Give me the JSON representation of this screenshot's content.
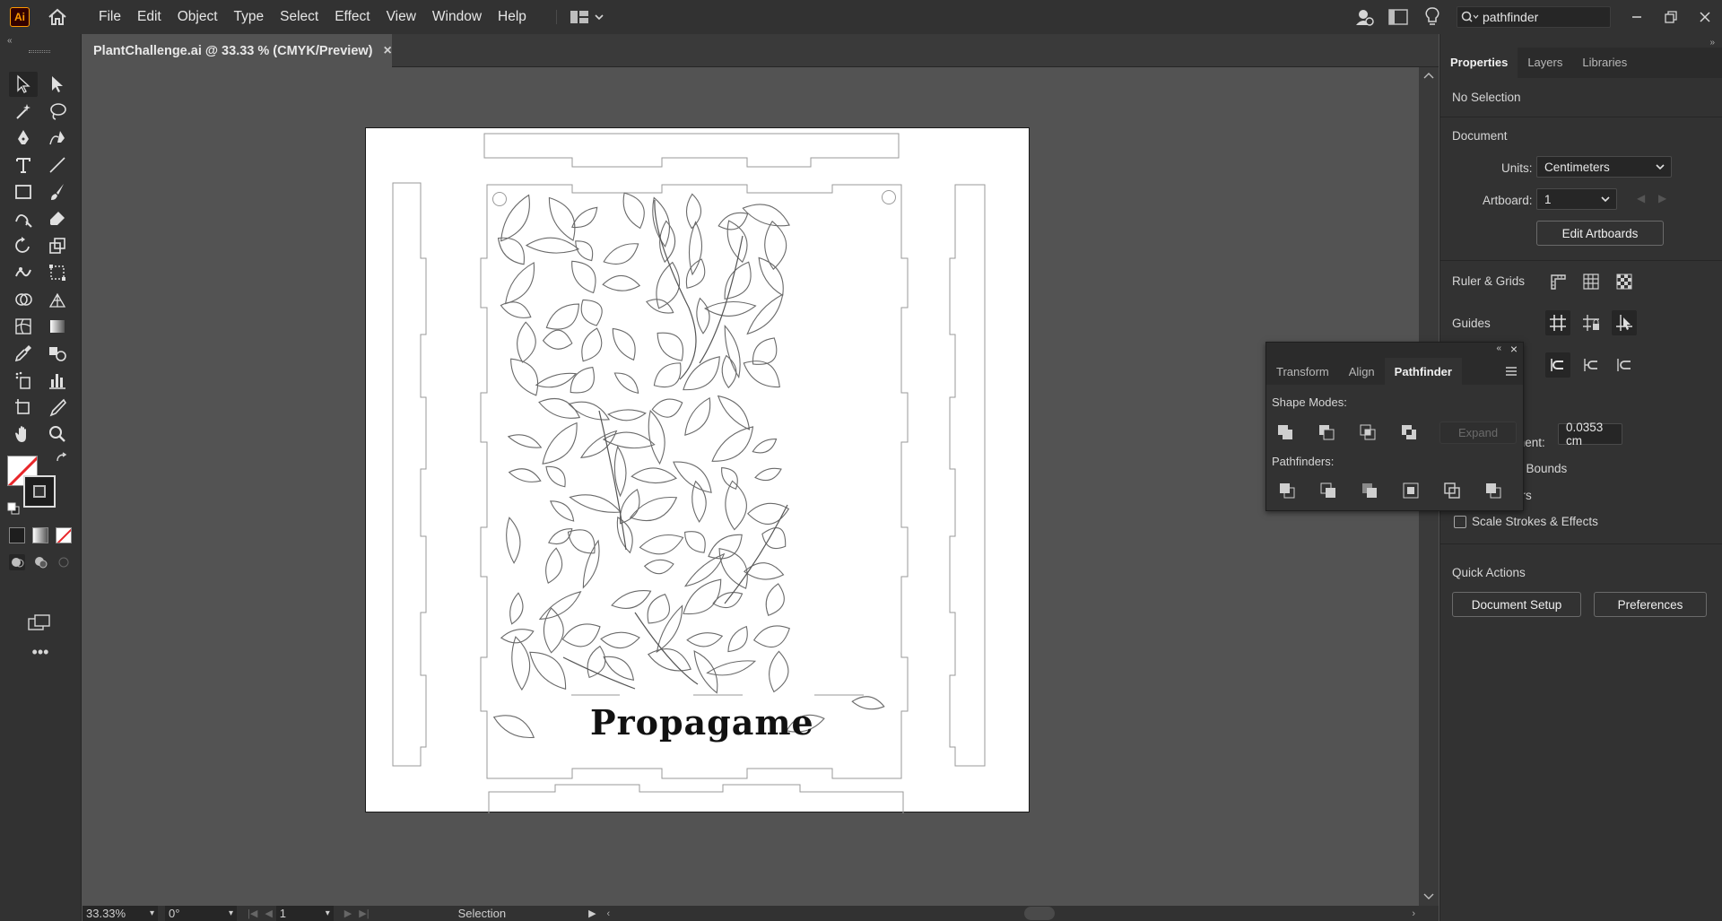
{
  "app": {
    "logo": "Ai"
  },
  "menu": [
    "File",
    "Edit",
    "Object",
    "Type",
    "Select",
    "Effect",
    "View",
    "Window",
    "Help"
  ],
  "search": {
    "value": "pathfinder"
  },
  "document": {
    "tab_title": "PlantChallenge.ai @ 33.33 % (CMYK/Preview)",
    "close": "×"
  },
  "artwork": {
    "title_text": "Propagame"
  },
  "statusbar": {
    "zoom": "33.33%",
    "rotation": "0°",
    "artboard": "1",
    "tool": "Selection"
  },
  "properties": {
    "tabs": [
      "Properties",
      "Layers",
      "Libraries"
    ],
    "selection": "No Selection",
    "document_heading": "Document",
    "units_label": "Units:",
    "units_value": "Centimeters",
    "artboard_label": "Artboard:",
    "artboard_value": "1",
    "edit_artboards": "Edit Artboards",
    "ruler_grids": "Ruler & Grids",
    "guides": "Guides",
    "increment_label": "ment:",
    "increment_value": "0.0353 cm",
    "view_bounds": "w Bounds",
    "corners": "ers",
    "scale_strokes": "Scale Strokes & Effects",
    "quick_actions": "Quick Actions",
    "document_setup": "Document Setup",
    "preferences": "Preferences"
  },
  "pathfinder": {
    "tabs": [
      "Transform",
      "Align",
      "Pathfinder"
    ],
    "shape_modes": "Shape Modes:",
    "pathfinders": "Pathfinders:",
    "expand": "Expand"
  }
}
